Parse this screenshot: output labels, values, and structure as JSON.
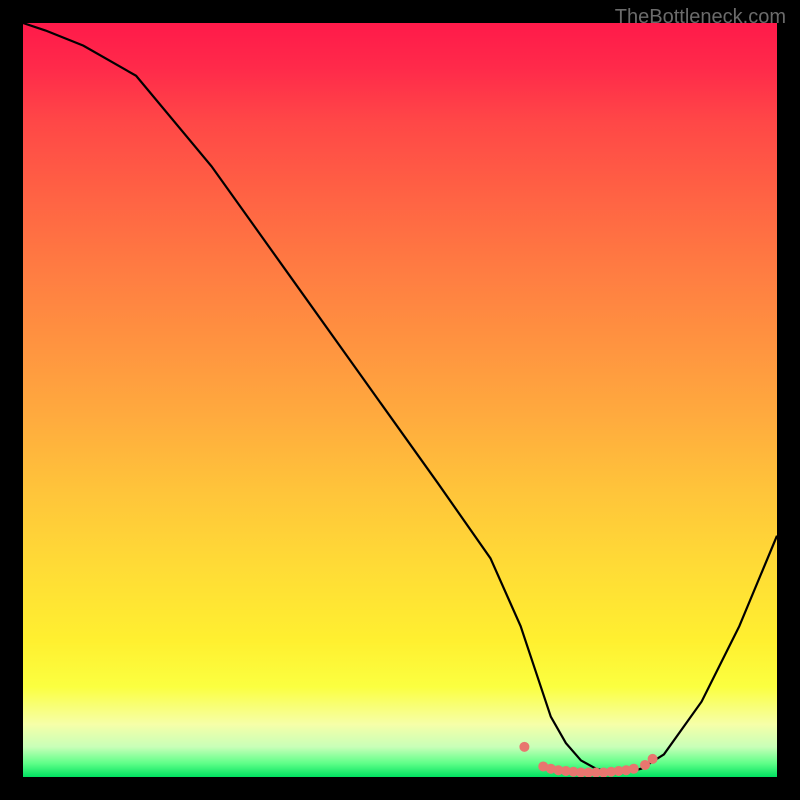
{
  "watermark": "TheBottleneck.com",
  "chart_data": {
    "type": "line",
    "title": "",
    "xlabel": "",
    "ylabel": "",
    "xlim": [
      0,
      100
    ],
    "ylim": [
      0,
      100
    ],
    "grid": false,
    "series": [
      {
        "name": "curve",
        "x": [
          0,
          3,
          8,
          15,
          25,
          35,
          45,
          55,
          62,
          66,
          68,
          70,
          72,
          74,
          76,
          78,
          80,
          82,
          85,
          90,
          95,
          100
        ],
        "values": [
          100,
          99,
          97,
          93,
          81,
          67,
          53,
          39,
          29,
          20,
          14,
          8,
          4.5,
          2.2,
          1.1,
          0.6,
          0.6,
          1.1,
          3.0,
          10,
          20,
          32
        ]
      }
    ],
    "markers": {
      "name": "flat-region",
      "x": [
        66.5,
        69,
        70,
        71,
        72,
        73,
        74,
        75,
        76,
        77,
        78,
        79,
        80,
        81,
        82.5,
        83.5
      ],
      "values": [
        4.0,
        1.4,
        1.1,
        0.9,
        0.8,
        0.7,
        0.6,
        0.6,
        0.6,
        0.6,
        0.7,
        0.8,
        0.9,
        1.1,
        1.6,
        2.4
      ]
    },
    "colors": {
      "curve": "#000000",
      "markers": "#e8766f",
      "gradient_top": "#ff1a4a",
      "gradient_mid": "#ffdb36",
      "gradient_bottom": "#00e060"
    }
  }
}
